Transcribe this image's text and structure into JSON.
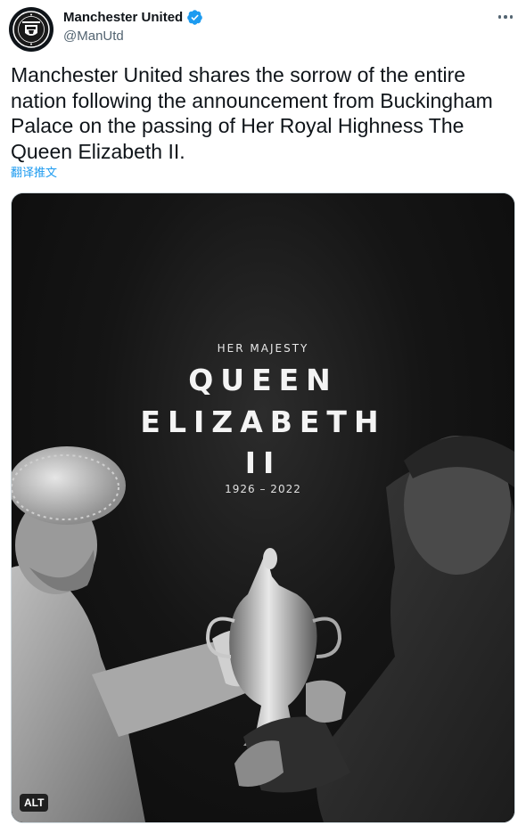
{
  "author": {
    "display_name": "Manchester United",
    "handle": "@ManUtd",
    "avatar_icon": "club-crest-icon",
    "verified_icon": "verified-badge-icon",
    "verified_color": "#1d9bf0",
    "crest_text": "MANCHESTER UNITED"
  },
  "more_icon": "more-horizontal-icon",
  "tweet": {
    "text": "Manchester United shares the sorrow of the entire nation following the announcement from Buckingham Palace on the passing of Her Royal Highness The Queen Elizabeth II.",
    "translate_label": "翻译推文"
  },
  "media": {
    "eyebrow": "HER MAJESTY",
    "title_line1": "QUEEN",
    "title_line2": "ELIZABETH",
    "title_line3": "II",
    "years": "1926 – 2022",
    "alt_label": "ALT"
  },
  "colors": {
    "link": "#1d9bf0",
    "secondary_text": "#536471",
    "primary_text": "#0f1419"
  }
}
